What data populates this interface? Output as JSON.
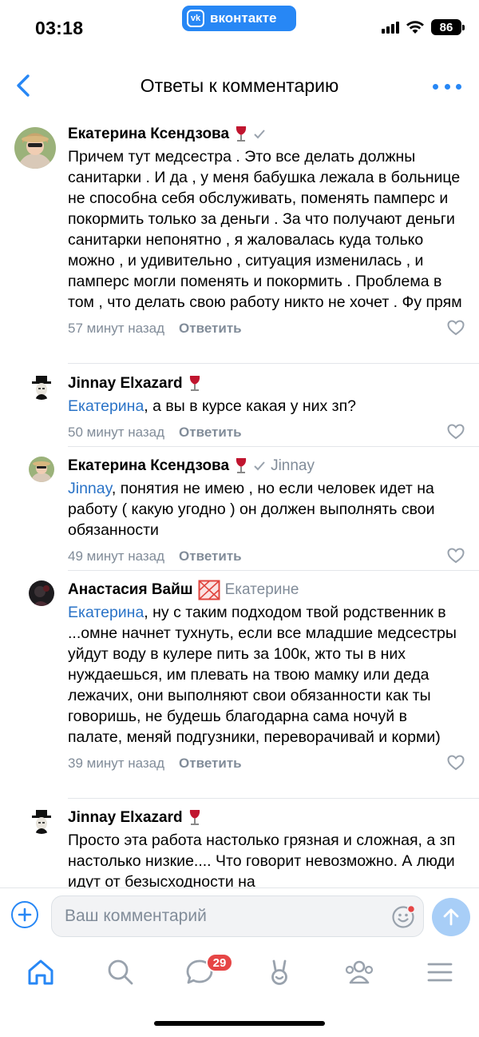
{
  "status_bar": {
    "time": "03:18",
    "app_pill": "вконтакте",
    "vk_logo": "vk",
    "battery": "86"
  },
  "header": {
    "title": "Ответы к комментарию",
    "back_icon": "chevron-left-icon",
    "more_icon": "more-dots-icon"
  },
  "colors": {
    "accent": "#2787f5",
    "mention": "#2a73c7",
    "meta": "#818c99",
    "badge": "#e64646"
  },
  "comments": [
    {
      "author": "Екатерина Ксендзова",
      "reply_to": "",
      "mention": "",
      "text": "Причем тут медсестра . Это все делать должны санитарки . И да , у меня бабушка лежала в больнице не способна себя обслуживать, поменять памперс и покормить только за деньги . За что получают деньги санитарки непонятно , я жаловалась куда только можно , и удивительно , ситуация изменилась , и памперс могли поменять и покормить . Проблема в том , что делать свою работу никто не хочет . Фу прям",
      "time": "57 минут назад",
      "reply_label": "Ответить"
    },
    {
      "author": "Jinnay Elxazard",
      "reply_to": "",
      "mention": "Екатерина",
      "text": ", а вы в курсе какая у них зп?",
      "time": "50 минут назад",
      "reply_label": "Ответить"
    },
    {
      "author": "Екатерина Ксендзова",
      "reply_to": "Jinnay",
      "mention": "Jinnay",
      "text": ", понятия не имею , но если человек идет на работу ( какую угодно ) он должен выполнять свои обязанности",
      "time": "49 минут назад",
      "reply_label": "Ответить"
    },
    {
      "author": "Анастасия Вайш",
      "reply_to": "Екатерине",
      "mention": "Екатерина",
      "text": ", ну с таким подходом твой родственник в ...омне начнет тухнуть, если все младшие медсестры уйдут воду в кулере пить за 100к, жто ты в них нуждаешься, им плевать на твою мамку или деда лежачих, они выполняют свои обязанности как ты говоришь, не будешь благодарна сама ночуй в палате, меняй подгузники, переворачивай и корми)",
      "time": "39 минут назад",
      "reply_label": "Ответить"
    },
    {
      "author": "Jinnay Elxazard",
      "reply_to": "",
      "mention": "",
      "text": "Просто эта работа настолько грязная и сложная, а зп настолько низкие.... Что говорит невозможно. А люди идут от безысходности на",
      "time": "",
      "reply_label": ""
    }
  ],
  "composer": {
    "placeholder": "Ваш комментарий"
  },
  "tab_bar": {
    "messages_badge": "29"
  }
}
